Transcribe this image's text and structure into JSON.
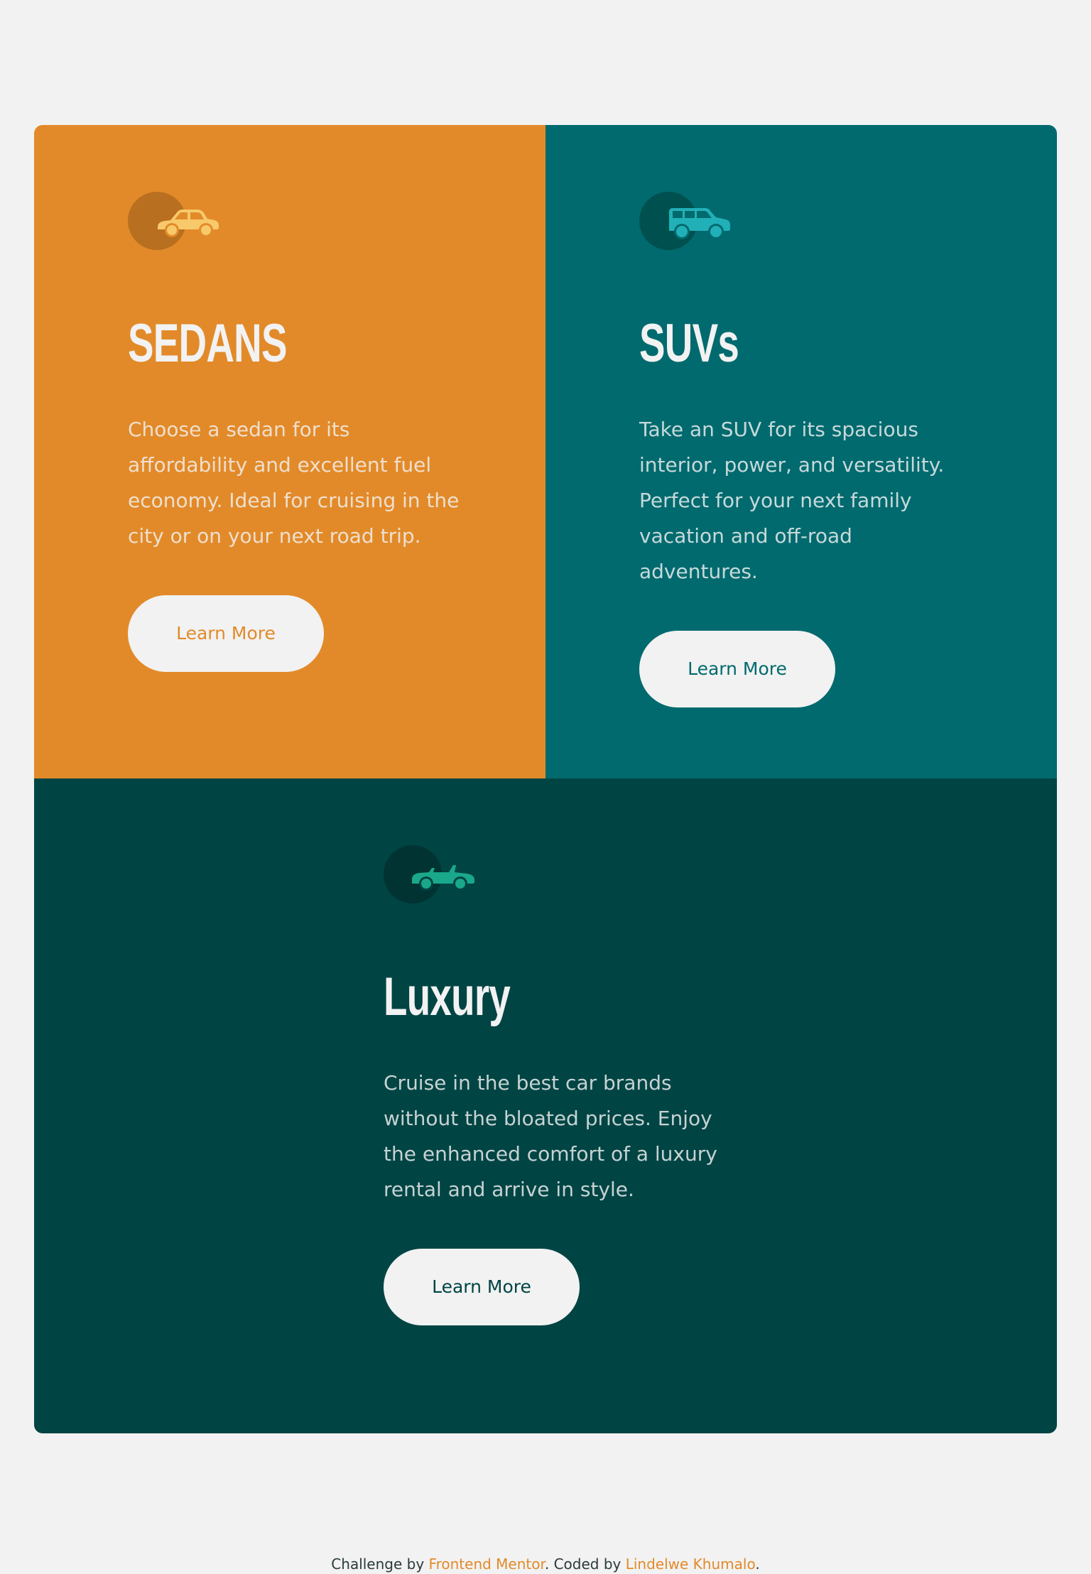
{
  "cards": [
    {
      "id": "sedans",
      "icon": "sedan-car-icon",
      "title": "SEDANS",
      "text": "Choose a sedan for its affordability and excellent fuel economy. Ideal for cruising in the city or on your next road trip.",
      "button": "Learn More"
    },
    {
      "id": "suvs",
      "icon": "suv-car-icon",
      "title": "SUVs",
      "text": "Take an SUV for its spacious interior, power, and versatility. Perfect for your next family vacation and off-road adventures.",
      "button": "Learn More"
    },
    {
      "id": "luxury",
      "icon": "luxury-car-icon",
      "title": "Luxury",
      "text": "Cruise in the best car brands without the bloated prices. Enjoy the enhanced comfort of a luxury rental and arrive in style.",
      "button": "Learn More"
    }
  ],
  "footer": {
    "prefix": "Challenge by ",
    "link1": "Frontend Mentor",
    "middle": ". Coded by ",
    "link2": "Lindelwe Khumalo",
    "suffix": "."
  },
  "colors": {
    "background": "#f2f2f2",
    "sedans": "#e28a29",
    "suvs": "#006a6e",
    "luxury": "#004444",
    "sedan_icon": "#f8c96a",
    "suv_icon": "#22b0b8",
    "luxury_icon": "#1aa88a"
  }
}
